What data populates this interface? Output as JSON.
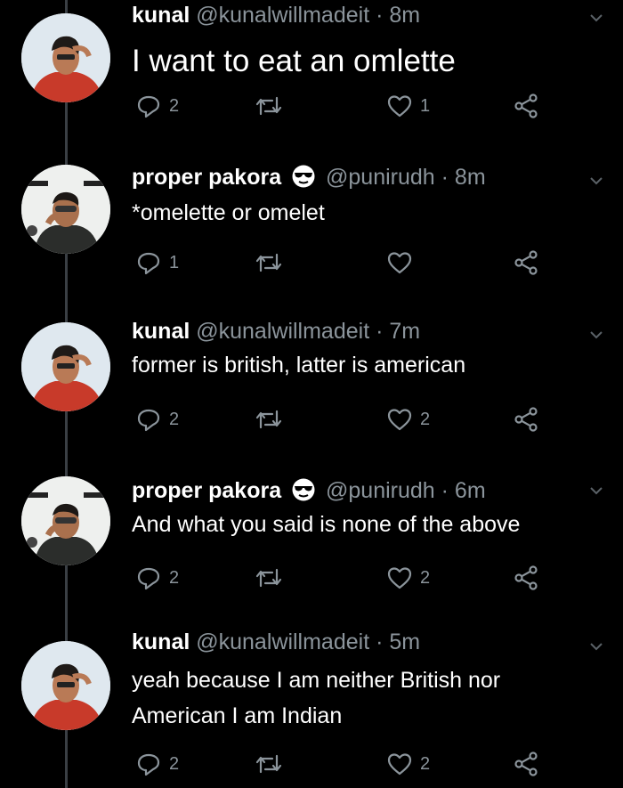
{
  "tweets": [
    {
      "name": "kunal",
      "handle": "@kunalwillmadeit",
      "time": "· 8m",
      "has_emoji": false,
      "text": [
        "I want to eat an omlette"
      ],
      "replies": "2",
      "retweets": "",
      "likes": "1",
      "avatar": "kunal"
    },
    {
      "name": "proper pakora",
      "handle": "@punirudh",
      "time": "· 8m",
      "has_emoji": true,
      "text": [
        "*omelette or omelet"
      ],
      "replies": "1",
      "retweets": "",
      "likes": "",
      "avatar": "pakora"
    },
    {
      "name": "kunal",
      "handle": "@kunalwillmadeit",
      "time": "· 7m",
      "has_emoji": false,
      "text": [
        "former is british, latter is american"
      ],
      "replies": "2",
      "retweets": "",
      "likes": "2",
      "avatar": "kunal"
    },
    {
      "name": "proper pakora",
      "handle": "@punirudh",
      "time": "· 6m",
      "has_emoji": true,
      "text": [
        "And what you said is none of the above"
      ],
      "replies": "2",
      "retweets": "",
      "likes": "2",
      "avatar": "pakora"
    },
    {
      "name": "kunal",
      "handle": "@kunalwillmadeit",
      "time": "· 5m",
      "has_emoji": false,
      "text": [
        "yeah because I am neither British nor",
        "American I am Indian"
      ],
      "replies": "2",
      "retweets": "",
      "likes": "2",
      "avatar": "kunal"
    }
  ],
  "icons": {
    "reply": "reply-icon",
    "retweet": "retweet-icon",
    "like": "heart-icon",
    "share": "share-icon",
    "menu": "chevron-down-icon",
    "emoji": "sunglasses-emoji-icon"
  },
  "colors": {
    "background": "#000000",
    "text": "#ffffff",
    "muted": "#8b949b",
    "thread_line": "#3a3f44"
  }
}
